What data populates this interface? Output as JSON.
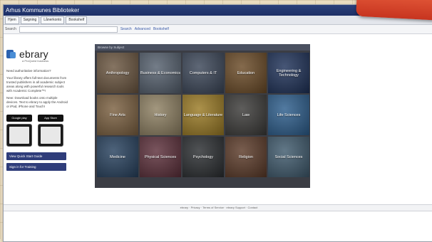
{
  "window": {
    "title": "Arhus Kommunes Biblioteker"
  },
  "toolbar": {
    "buttons": [
      "Hjem",
      "Søgning",
      "Lånerkonto",
      "Bookshelf"
    ]
  },
  "search": {
    "label": "Search",
    "placeholder": "",
    "go_label": "Search",
    "links": [
      "Advanced",
      "Bookshelf"
    ]
  },
  "sidebar": {
    "logo_text": "ebrary",
    "logo_sub": "a ProQuest business",
    "heading": "Need authoritative information?",
    "description": "Your library offers full-text documents from trusted publishers in all academic subject areas along with powerful research tools with Academic Complete™!",
    "new_text": "New: Download books onto multiple devices. Text to ebrary to apply the Android or iPad, iPhone and Touch!",
    "stores": [
      "Google play",
      "App Store"
    ],
    "buttons": [
      "View Quick Start Guide",
      "Sign in for Training"
    ]
  },
  "panel": {
    "heading": "Browse by Subject",
    "tiles": [
      {
        "label": "Anthropology",
        "color": "#6b5640"
      },
      {
        "label": "Business & Economics",
        "color": "#55606e"
      },
      {
        "label": "Computers & IT",
        "color": "#3b4658"
      },
      {
        "label": "Education",
        "color": "#6a4a26"
      },
      {
        "label": "Engineering & Technology",
        "color": "#1e3158"
      },
      {
        "label": "Fine Arts",
        "color": "#7b6040"
      },
      {
        "label": "History",
        "color": "#8e8062"
      },
      {
        "label": "Language & Literature",
        "color": "#9a7a24"
      },
      {
        "label": "Law",
        "color": "#3b3a38"
      },
      {
        "label": "Life Sciences",
        "color": "#2c5d8c"
      },
      {
        "label": "Medicine",
        "color": "#27415e"
      },
      {
        "label": "Physical Sciences",
        "color": "#5c2f3a"
      },
      {
        "label": "Psychology",
        "color": "#2a2d30"
      },
      {
        "label": "Religion",
        "color": "#5b3a28"
      },
      {
        "label": "Social Sciences",
        "color": "#3f5a6d"
      }
    ]
  },
  "footer": {
    "text": "ebrary · Privacy · Terms of Service · ebrary Support · Contact"
  }
}
